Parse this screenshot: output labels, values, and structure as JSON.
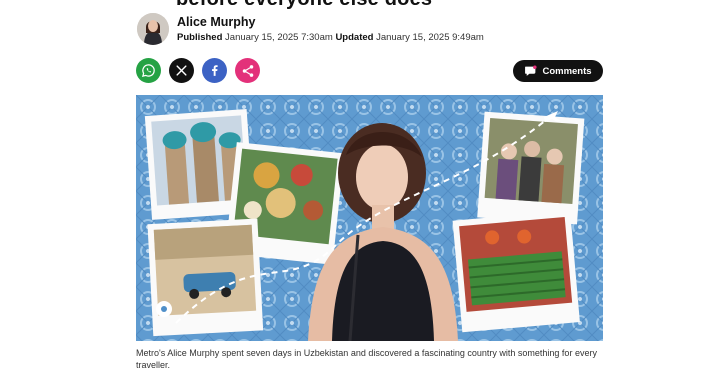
{
  "article": {
    "headline_fragment": "before everyone else does",
    "author": "Alice Murphy",
    "published_label": "Published",
    "published_time": "January 15, 2025 7:30am",
    "updated_label": "Updated",
    "updated_time": "January 15, 2025 9:49am",
    "comments_label": "Comments",
    "caption": "Metro's Alice Murphy spent seven days in Uzbekistan and discovered a fascinating country with something for every traveller."
  },
  "share_icons": [
    "whatsapp-icon",
    "x-icon",
    "facebook-icon",
    "share-icon"
  ],
  "colors": {
    "whatsapp": "#25a244",
    "x": "#111111",
    "facebook": "#3c62c4",
    "share": "#e3317a",
    "comments_button": "#111111",
    "hero_tile_blue": "#4f8fc9"
  }
}
